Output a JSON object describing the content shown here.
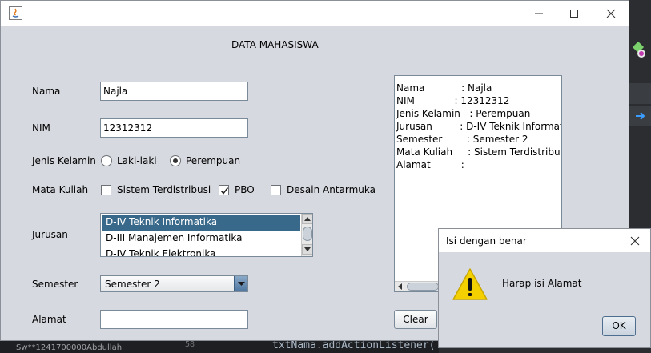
{
  "window": {
    "title": ""
  },
  "form": {
    "heading": "DATA MAHASISWA",
    "labels": {
      "nama": "Nama",
      "nim": "NIM",
      "jenis_kelamin": "Jenis Kelamin",
      "mata_kuliah": "Mata Kuliah",
      "jurusan": "Jurusan",
      "semester": "Semester",
      "alamat": "Alamat"
    },
    "nama_value": "Najla",
    "nim_value": "12312312",
    "alamat_value": "",
    "gender_options": [
      {
        "label": "Laki-laki",
        "selected": false
      },
      {
        "label": "Perempuan",
        "selected": true
      }
    ],
    "courses": [
      {
        "label": "Sistem Terdistribusi",
        "checked": false
      },
      {
        "label": "PBO",
        "checked": true
      },
      {
        "label": "Desain Antarmuka",
        "checked": false
      }
    ],
    "jurusan_items": [
      {
        "label": "D-IV Teknik Informatika",
        "selected": true
      },
      {
        "label": "D-III Manajemen Informatika",
        "selected": false
      },
      {
        "label": "D-IV Teknik Elektronika",
        "selected": false
      }
    ],
    "semester_selected": "Semester 2",
    "clear_label": "Clear"
  },
  "output": {
    "lines": [
      "Nama            : Najla",
      "NIM             : 12312312",
      "Jenis Kelamin   : Perempuan",
      "Jurusan         : D-IV Teknik Informatika",
      "Semester        : Semester 2",
      "Mata Kuliah     : Sistem TerdistribusiD",
      "Alamat          :"
    ]
  },
  "dialog": {
    "title": "Isi dengan benar",
    "message": "Harap isi Alamat",
    "ok_label": "OK"
  },
  "ide": {
    "line_number": "58",
    "code_fragment": "txtNama.addActionListener(",
    "tab_label": "Sw**1241700000Abdullah"
  },
  "colors": {
    "selection": "#39698a",
    "window_bg": "#d6d9df",
    "warning": "#f5d000"
  }
}
